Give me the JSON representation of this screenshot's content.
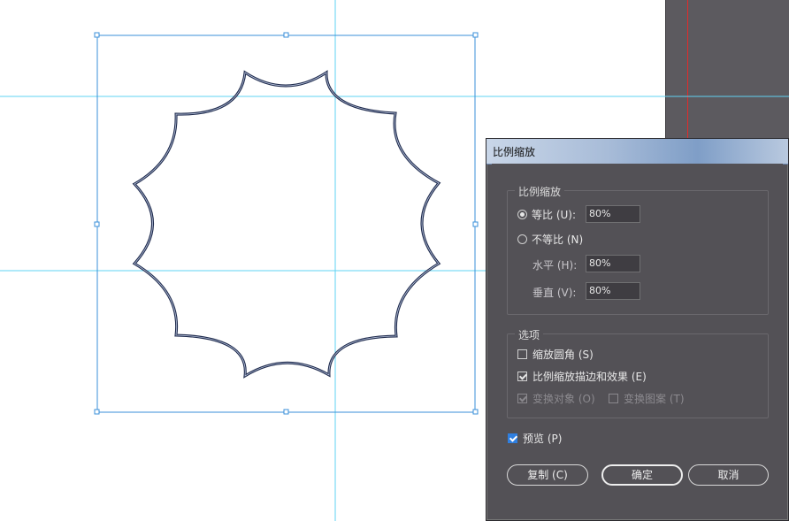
{
  "dialog": {
    "title": "比例缩放",
    "scale_group": {
      "legend": "比例缩放",
      "uniform_label": "等比 (U):",
      "uniform_value": "80%",
      "uniform_selected": true,
      "nonuniform_label": "不等比 (N)",
      "horizontal_label": "水平 (H):",
      "horizontal_value": "80%",
      "vertical_label": "垂直 (V):",
      "vertical_value": "80%"
    },
    "options_group": {
      "legend": "选项",
      "scale_corners_label": "缩放圆角 (S)",
      "scale_corners_checked": false,
      "scale_strokes_label": "比例缩放描边和效果 (E)",
      "scale_strokes_checked": true,
      "transform_objects_label": "变换对象 (O)",
      "transform_objects_checked": true,
      "transform_patterns_label": "变换图案 (T)",
      "transform_patterns_checked": false
    },
    "preview_label": "预览 (P)",
    "preview_checked": true,
    "copy_button": "复制 (C)",
    "ok_button": "确定",
    "cancel_button": "取消"
  },
  "colors": {
    "guide": "#5fd3f3",
    "selection": "#3a8fd8",
    "shape_stroke": "#1f2b4d",
    "panel_bg": "#5c5a5f",
    "dialog_bg": "#535156"
  }
}
